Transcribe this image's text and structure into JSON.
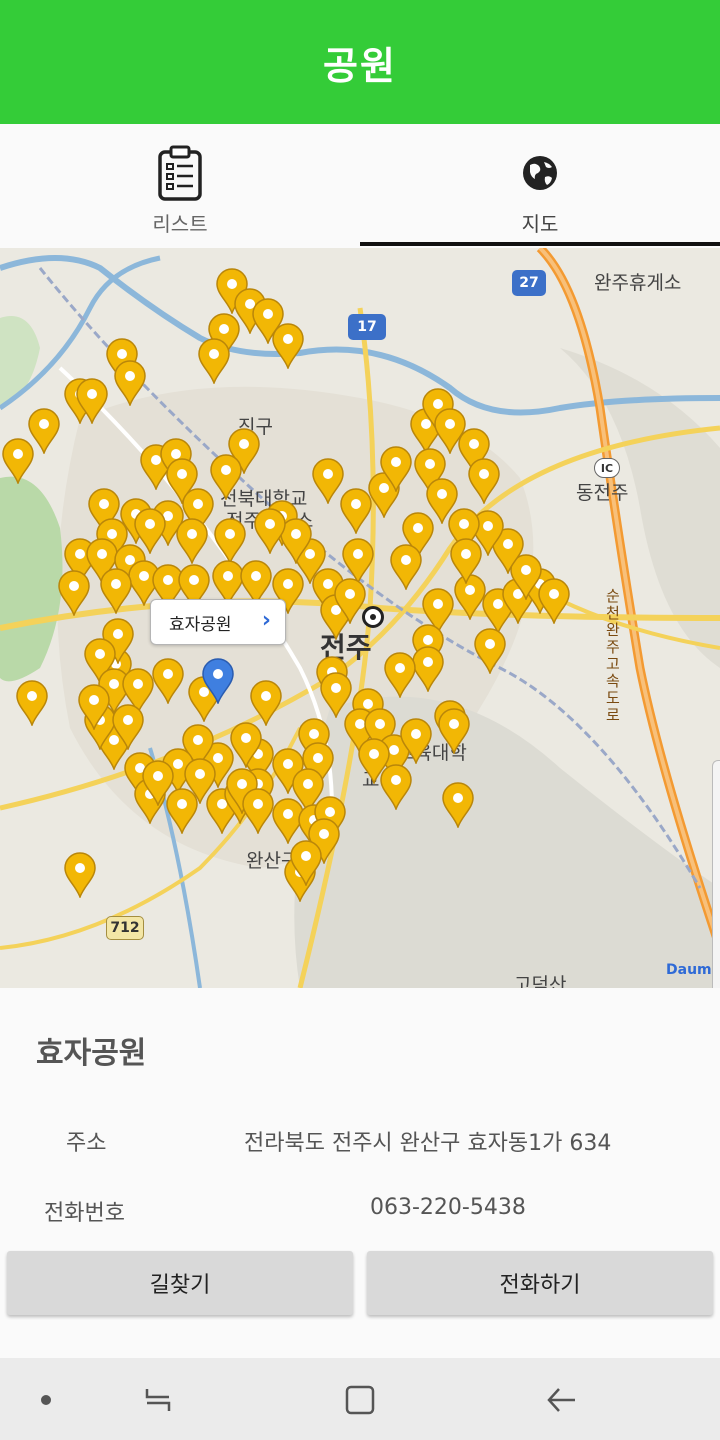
{
  "header": {
    "title": "공원"
  },
  "tabs": [
    {
      "label": "리스트",
      "icon": "clipboard-list-icon",
      "active": false
    },
    {
      "label": "지도",
      "icon": "globe-icon",
      "active": true
    }
  ],
  "map": {
    "callout": "효자공원",
    "labels": {
      "rest_area": "완주휴게소",
      "ic": "동전주",
      "district_n": "진구",
      "university": "전북대학교",
      "campus": "전주캠퍼스",
      "city": "전주",
      "edu_univ": "전주교육대학교",
      "district_s": "완산구",
      "expressway": "순천완주고속도로",
      "mountain": "고덕산",
      "daum_logo": "Daum"
    },
    "road_numbers": {
      "national_17": "17",
      "national_27": "27",
      "local_712": "712",
      "ic_badge": "IC"
    },
    "colors": {
      "marker": "#f2b705",
      "selected_marker": "#3f7fe0",
      "expressway": "#f39a32",
      "river": "#8cb7da"
    }
  },
  "details": {
    "name": "효자공원",
    "address_label": "주소",
    "address_value": "전라북도 전주시 완산구 효자동1가 634",
    "phone_label": "전화번호",
    "phone_value": "063-220-5438"
  },
  "buttons": {
    "directions": "길찾기",
    "call": "전화하기"
  },
  "navbar": {
    "icons": [
      "dot-icon",
      "recent-apps-icon",
      "home-icon",
      "back-icon"
    ]
  }
}
